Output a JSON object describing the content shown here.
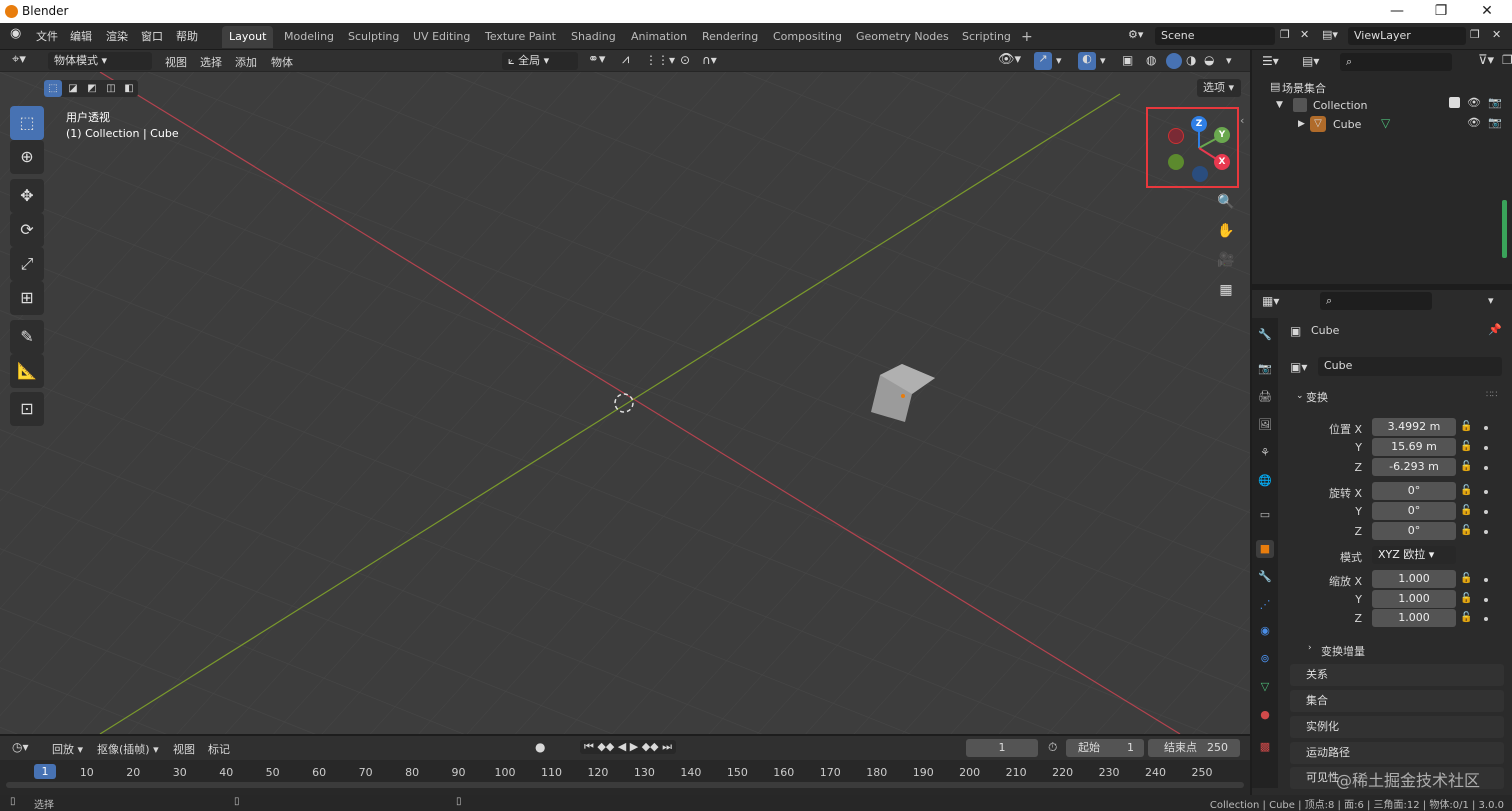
{
  "titlebar": {
    "app": "Blender",
    "min": "—",
    "max": "❐",
    "close": "✕"
  },
  "menu": [
    "文件",
    "编辑",
    "渲染",
    "窗口",
    "帮助"
  ],
  "workspaces": [
    "Layout",
    "Modeling",
    "Sculpting",
    "UV Editing",
    "Texture Paint",
    "Shading",
    "Animation",
    "Rendering",
    "Compositing",
    "Geometry Nodes",
    "Scripting"
  ],
  "workspace_add": "+",
  "scene": {
    "value": "Scene"
  },
  "viewlayer": {
    "value": "ViewLayer"
  },
  "header3d": {
    "mode": "物体模式",
    "view": "视图",
    "select": "选择",
    "add": "添加",
    "object": "物体",
    "orientation": "全局",
    "options": "选项"
  },
  "viewport": {
    "perspective": "用户透视",
    "collection_info": "(1) Collection | Cube"
  },
  "gizmo": {
    "z": "Z",
    "y": "Y",
    "x": "X",
    "color_x": "#e8394f",
    "color_y": "#6aa84f",
    "color_z": "#2f7fe6"
  },
  "outliner": {
    "root": "场景集合",
    "collection": "Collection",
    "object": "Cube",
    "search_placeholder": ""
  },
  "props": {
    "object_name": "Cube",
    "data_name": "Cube",
    "transform": "变换",
    "location_label": "位置 X",
    "loc_x": "3.4992 m",
    "loc_y": "15.69 m",
    "loc_z": "-6.293 m",
    "rotation_label": "旋转 X",
    "rot_x": "0°",
    "rot_y": "0°",
    "rot_z": "0°",
    "mode_label": "模式",
    "mode_value": "XYZ 欧拉",
    "scale_label": "缩放 X",
    "scale_x": "1.000",
    "scale_y": "1.000",
    "scale_z": "1.000",
    "y": "Y",
    "z": "Z",
    "delta": "变换增量",
    "relations": "关系",
    "collections": "集合",
    "instancing": "实例化",
    "motion_paths": "运动路径",
    "visibility": "可见性"
  },
  "timeline": {
    "playback": "回放",
    "keying": "抠像(插帧)",
    "view": "视图",
    "marker": "标记",
    "current_frame": "1",
    "start_label": "起始",
    "start": "1",
    "end_label": "结束点",
    "end": "250",
    "frames": [
      "1",
      "10",
      "20",
      "30",
      "40",
      "50",
      "60",
      "70",
      "80",
      "90",
      "100",
      "110",
      "120",
      "130",
      "140",
      "150",
      "160",
      "170",
      "180",
      "190",
      "200",
      "210",
      "220",
      "230",
      "240",
      "250"
    ]
  },
  "statusbar": {
    "select": "选择",
    "info": "Collection | Cube | 顶点:8 | 面:6 | 三角面:12 | 物体:0/1 | 3.0.0",
    "watermark": "@稀土掘金技术社区"
  }
}
